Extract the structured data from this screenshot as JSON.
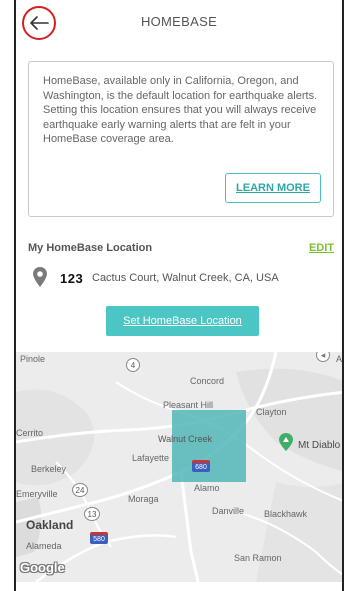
{
  "header": {
    "title": "HOMEBASE"
  },
  "info": {
    "text": "HomeBase, available only in California, Oregon, and Washington, is the default location for earthquake alerts. Setting this location ensures that you will always receive earthquake early warning alerts that are felt in your HomeBase coverage area.",
    "learn_more_label": "LEARN MORE"
  },
  "location": {
    "heading": "My HomeBase Location",
    "edit_label": "EDIT",
    "address_number": "123",
    "address_text": "Cactus Court, Walnut Creek, CA, USA"
  },
  "set_button_label": "Set HomeBase Location",
  "map": {
    "labels": {
      "pinole": "Pinole",
      "concord": "Concord",
      "pleasant_hill": "Pleasant Hill",
      "clayton": "Clayton",
      "cerrito": "Cerrito",
      "walnut_creek": "Walnut Creek",
      "lafayette": "Lafayette",
      "mt_diablo": "Mt Diablo",
      "berkeley": "Berkeley",
      "emeryville": "Emeryville",
      "moraga": "Moraga",
      "alamo": "Alamo",
      "danville": "Danville",
      "blackhawk": "Blackhawk",
      "oakland": "Oakland",
      "alameda": "Alameda",
      "san_ramon": "San Ramon",
      "an": "An"
    },
    "shields": {
      "r4": "4",
      "r24": "24",
      "r13": "13",
      "i680": "680",
      "i580": "580"
    },
    "attribution": "Google",
    "highlight_color": "#4cb5b5"
  }
}
